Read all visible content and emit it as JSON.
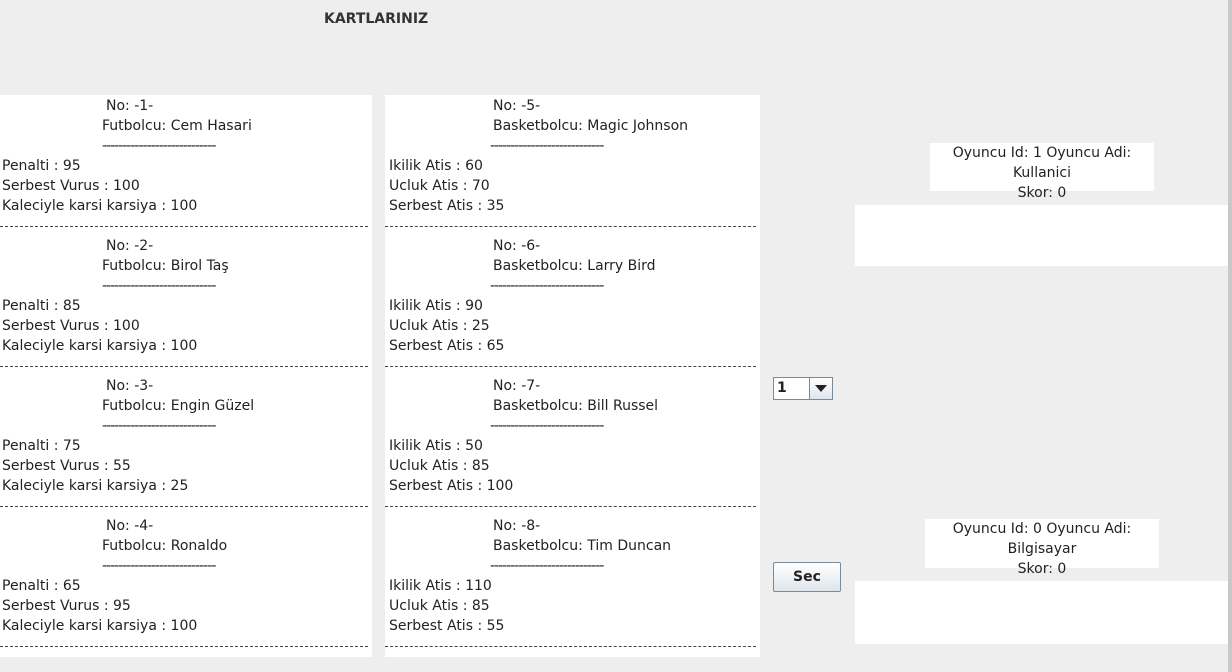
{
  "header": {
    "title": "KARTLARINIZ"
  },
  "separator": "----------------------------",
  "divider": "---------------------------------------------------------------------------------------",
  "football_cards": [
    {
      "no": "No: -1-",
      "name": "Futbolcu: Cem Hasari",
      "stats": [
        "Penalti : 95",
        "Serbest Vurus : 100",
        "Kaleciyle karsi karsiya : 100"
      ]
    },
    {
      "no": "No: -2-",
      "name": "Futbolcu: Birol Taş",
      "stats": [
        "Penalti : 85",
        "Serbest Vurus : 100",
        "Kaleciyle karsi karsiya : 100"
      ]
    },
    {
      "no": "No: -3-",
      "name": "Futbolcu: Engin Güzel",
      "stats": [
        "Penalti : 75",
        "Serbest Vurus : 55",
        "Kaleciyle karsi karsiya : 25"
      ]
    },
    {
      "no": "No: -4-",
      "name": "Futbolcu: Ronaldo",
      "stats": [
        "Penalti : 65",
        "Serbest Vurus : 95",
        "Kaleciyle karsi karsiya : 100"
      ]
    }
  ],
  "basketball_cards": [
    {
      "no": "No: -5-",
      "name": "Basketbolcu: Magic Johnson",
      "stats": [
        "Ikilik Atis : 60",
        "Ucluk Atis : 70",
        "Serbest Atis : 35"
      ]
    },
    {
      "no": "No: -6-",
      "name": "Basketbolcu: Larry Bird",
      "stats": [
        "Ikilik Atis : 90",
        "Ucluk Atis : 25",
        "Serbest Atis : 65"
      ]
    },
    {
      "no": "No: -7-",
      "name": "Basketbolcu: Bill Russel",
      "stats": [
        "Ikilik Atis : 50",
        "Ucluk Atis : 85",
        "Serbest Atis : 100"
      ]
    },
    {
      "no": "No: -8-",
      "name": "Basketbolcu: Tim Duncan",
      "stats": [
        "Ikilik Atis : 110",
        "Ucluk Atis : 85",
        "Serbest Atis : 55"
      ]
    }
  ],
  "selector": {
    "value": "1",
    "icon": "chevron-down-icon"
  },
  "select_button": {
    "label": "Sec"
  },
  "player1": {
    "line1": "Oyuncu Id: 1 Oyuncu Adi: Kullanici",
    "line2": "Skor: 0"
  },
  "player2": {
    "line1": "Oyuncu Id: 0 Oyuncu Adi: Bilgisayar",
    "line2": "Skor: 0"
  }
}
